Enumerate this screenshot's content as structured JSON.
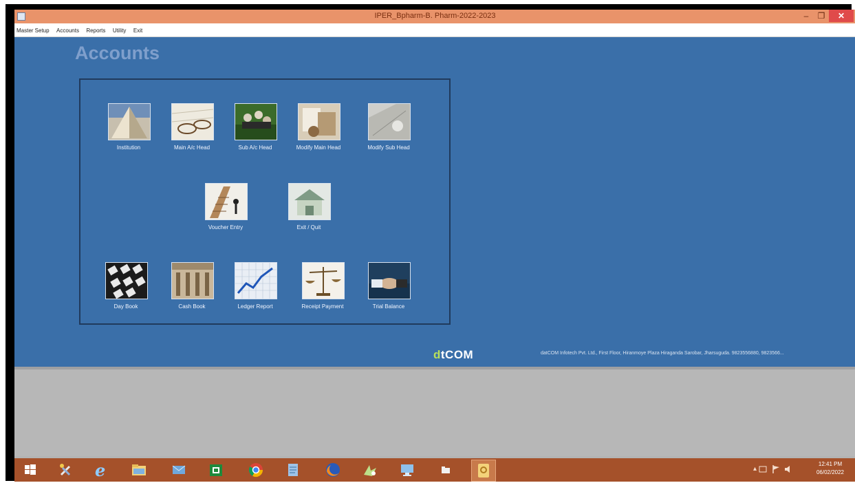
{
  "window": {
    "title": "IPER_Bpharm-B. Pharm-2022-2023",
    "min_glyph": "–",
    "max_glyph": "❐",
    "close_glyph": "✕"
  },
  "menu": [
    "Master Setup",
    "Accounts",
    "Reports",
    "Utility",
    "Exit"
  ],
  "page": {
    "heading": "Accounts"
  },
  "tiles": [
    {
      "label": "Institution",
      "icon": "pyramid-icon"
    },
    {
      "label": "Main A/c Head",
      "icon": "glasses-icon"
    },
    {
      "label": "Sub A/c Head",
      "icon": "team-icon"
    },
    {
      "label": "Modify Main Head",
      "icon": "documents-icon"
    },
    {
      "label": "Modify Sub Head",
      "icon": "chart-paper-icon"
    },
    {
      "label": "Voucher Entry",
      "icon": "climbing-coins-icon"
    },
    {
      "label": "Exit / Quit",
      "icon": "house-money-icon"
    },
    {
      "label": "Day Book",
      "icon": "calculator-keys-icon"
    },
    {
      "label": "Cash Book",
      "icon": "building-columns-icon"
    },
    {
      "label": "Ledger Report",
      "icon": "growth-chart-icon"
    },
    {
      "label": "Receipt Payment",
      "icon": "balance-scale-icon"
    },
    {
      "label": "Trial Balance",
      "icon": "handshake-icon"
    }
  ],
  "footer": {
    "logo_prefix": "d",
    "logo_rest": "tCOM",
    "company": "datCOM Infotech Pvt. Ltd., First Floor, Hiranmoye Plaza Hiraganda Sarobar, Jharsuguda. 9823556880, 9823566..."
  },
  "taskbar": {
    "apps": [
      "start-icon",
      "tools-icon",
      "internet-explorer-icon",
      "file-explorer-icon",
      "mail-icon",
      "excel-icon",
      "chrome-icon",
      "notepad-icon",
      "firefox-icon",
      "app-icon",
      "remote-desktop-icon",
      "folder-icon",
      "accounts-app-icon"
    ],
    "clock_time": "12:41 PM",
    "clock_date": "06/02/2022",
    "tray_text": "▴"
  },
  "colors": {
    "title_bar": "#e9936a",
    "main_bg": "#3a6fa9",
    "taskbar": "#a5512a",
    "close_button": "#e04a4a"
  }
}
